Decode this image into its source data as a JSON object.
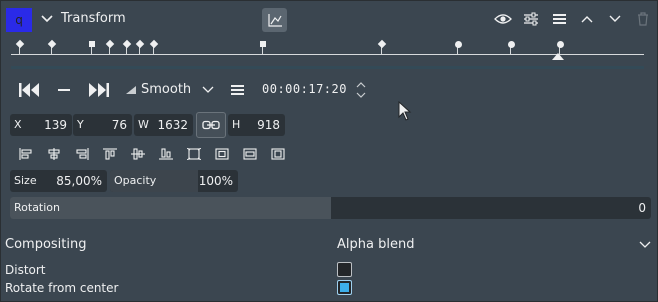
{
  "header": {
    "badge": "q",
    "title": "Transform"
  },
  "transport": {
    "interpolation": "Smooth",
    "timecode": "00:00:17:20"
  },
  "geometry": {
    "x_label": "X",
    "x_value": "139",
    "y_label": "Y",
    "y_value": "76",
    "w_label": "W",
    "w_value": "1632",
    "h_label": "H",
    "h_value": "918"
  },
  "size": {
    "label": "Size",
    "value": "85,00%"
  },
  "opacity": {
    "label": "Opacity",
    "value": "100%"
  },
  "rotation": {
    "label": "Rotation",
    "value": "0",
    "fraction": 0.5
  },
  "compositing": {
    "label": "Compositing",
    "value": "Alpha blend"
  },
  "distort": {
    "label": "Distort",
    "checked": false
  },
  "rotate_center": {
    "label": "Rotate from center",
    "checked": true
  },
  "colors": {
    "accent": "#3daee9",
    "badge": "#2a2ae8",
    "panel": "#3b4650"
  },
  "icons": [
    "chevron-down-icon",
    "keyframe-graph-icon",
    "eye-icon",
    "settings-sliders-icon",
    "menu-icon",
    "chevron-up-icon",
    "chevron-down-icon",
    "trash-icon",
    "skip-start-icon",
    "minus-icon",
    "skip-end-icon",
    "interpolation-icon",
    "link-icon",
    "align-left-icon",
    "align-hcenter-icon",
    "align-right-icon",
    "align-top-icon",
    "align-vcenter-icon",
    "align-bottom-icon",
    "fit-icon",
    "fill-icon",
    "fit-width-icon",
    "fit-height-icon"
  ]
}
